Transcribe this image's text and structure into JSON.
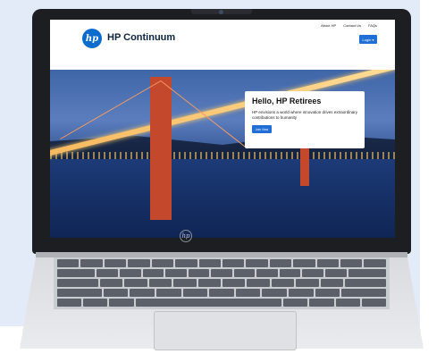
{
  "site": {
    "brand": "HP Continuum",
    "logo_text": "hp",
    "nav": [
      "About HP",
      "Contact Us",
      "FAQs"
    ],
    "login_label": "Login ▾"
  },
  "hero": {
    "title": "Hello, HP Retirees",
    "text": "HP envisions a world where innovation drives extraordinary contributions to humanity",
    "cta_label": "Join Now"
  },
  "device": {
    "lid_logo": "hp"
  },
  "colors": {
    "accent": "#1f6fd6",
    "brand_dark": "#0b2240",
    "bridge": "#c4482c"
  }
}
